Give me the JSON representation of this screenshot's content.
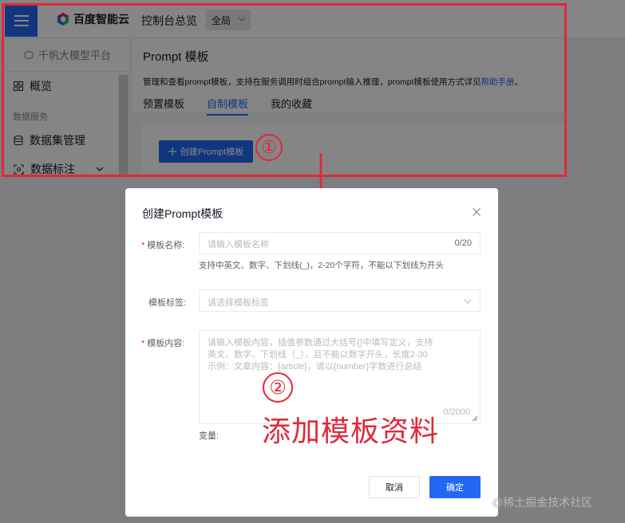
{
  "topbar": {
    "brand": "百度智能云",
    "console_link": "控制台总览",
    "region": "全局"
  },
  "sidebar": {
    "platform": "千帆大模型平台",
    "items": [
      {
        "label": "概览"
      },
      {
        "group": "数据服务"
      },
      {
        "label": "数据集管理"
      },
      {
        "label": "数据标注"
      }
    ]
  },
  "page": {
    "title": "Prompt 模板",
    "description": "管理和查看prompt模板，支持在服务调用时组合prompt输入推理，prompt模板使用方式详见",
    "help_link": "帮助手册",
    "description_end": "。",
    "tabs": [
      {
        "label": "预置模板",
        "active": false
      },
      {
        "label": "自制模板",
        "active": true
      },
      {
        "label": "我的收藏",
        "active": false
      }
    ],
    "create_button": "创建Prompt模板"
  },
  "annotations": {
    "step1": "①",
    "step2": "②",
    "note": "添加模板资料",
    "watermark": "@稀土掘金技术社区"
  },
  "modal": {
    "title": "创建Prompt模板",
    "name": {
      "label": "模板名称:",
      "placeholder": "请输入模板名称",
      "counter": "0/20",
      "hint": "支持中英文、数字、下划线(_)，2-20个字符，不能以下划线为开头"
    },
    "tag": {
      "label": "模板标签:",
      "placeholder": "请选择模板标签"
    },
    "content": {
      "label": "模板内容:",
      "placeholder_lines": [
        "请输入模板内容，插值参数通过大括号{}中填写定义，支持",
        "英文、数字、下划线（_），且不能以数字开头，长度2-30",
        "示例：文章内容：{article}，请以{number}字数进行总结"
      ],
      "counter": "0/2000"
    },
    "variables_label": "变量:",
    "cancel": "取消",
    "confirm": "确定"
  },
  "colors": {
    "accent": "#2468f2",
    "annotation_red": "#e0293a"
  }
}
